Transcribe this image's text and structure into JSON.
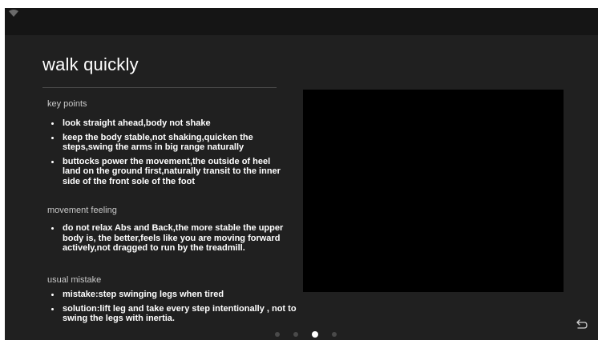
{
  "title": "walk quickly",
  "key_points": {
    "heading": "key points",
    "items": [
      "look straight ahead,body not shake",
      "keep the body stable,not shaking,quicken the steps,swing the arms in big range naturally",
      "buttocks power the movement,the outside of heel land on the ground first,naturally transit to the inner side of the front sole of the foot"
    ]
  },
  "movement_feeling": {
    "heading": "movement feeling",
    "items": [
      "do not relax Abs and Back,the more stable the upper body is, the better,feels like you are moving forward actively,not dragged to run by the treadmill."
    ]
  },
  "usual_mistake": {
    "heading": "usual mistake",
    "items": [
      "mistake:step swinging legs when tired",
      "solution:lift leg and take every step intentionally , not to swing the legs with inertia."
    ]
  },
  "pagination": {
    "total": 4,
    "active_index": 2
  },
  "icons": {
    "status": "wifi-icon",
    "nav": "back-icon"
  },
  "colors": {
    "background": "#202020",
    "status_bar": "#151515",
    "video": "#000000",
    "dot_inactive": "#4a4a4a",
    "dot_active": "#ffffff"
  }
}
